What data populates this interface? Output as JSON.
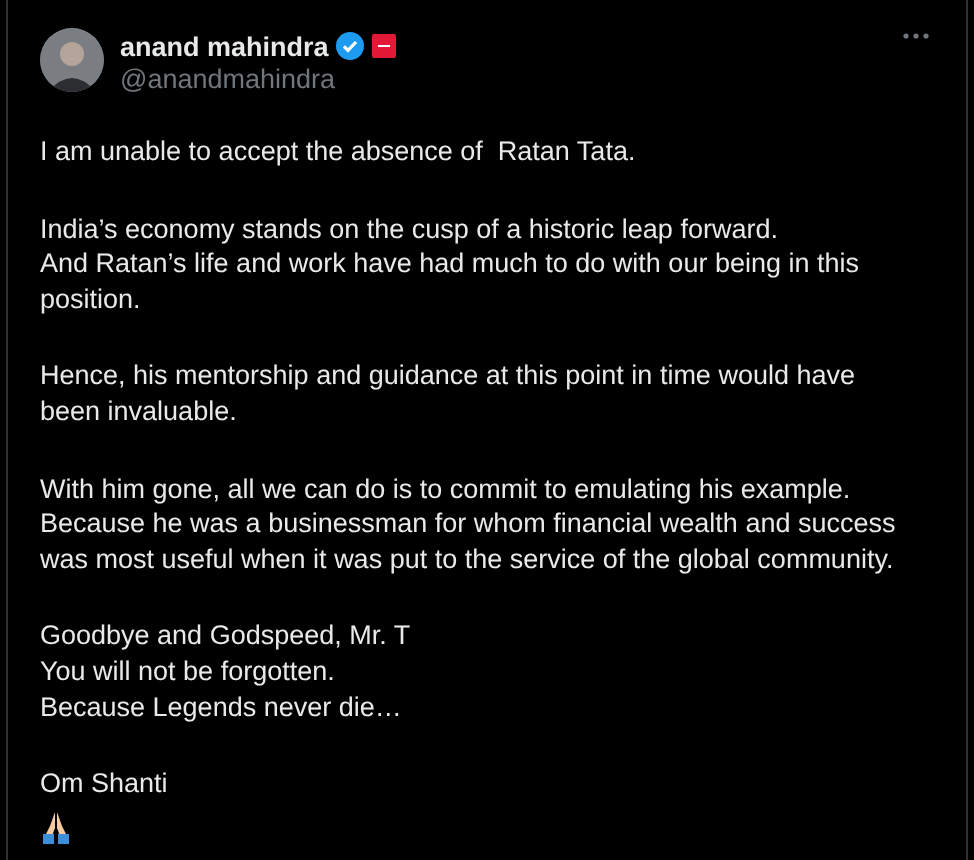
{
  "author": {
    "name": "anand mahindra",
    "handle": "@anandmahindra",
    "verified": true
  },
  "paragraphs": [
    [
      "I am unable to accept the absence of  Ratan Tata."
    ],
    [
      "India’s economy stands on the cusp of a historic leap forward.",
      "And Ratan’s life and work have had much to do with our being in this",
      "position."
    ],
    [
      "Hence, his mentorship and guidance at this point in time would have",
      "been invaluable."
    ],
    [
      "With him gone, all we can do is to commit to emulating his example.",
      "Because he was a businessman for whom financial wealth and success",
      "was most useful when it was put to the service of the global community."
    ],
    [
      "Goodbye and Godspeed, Mr. T",
      "You will not be forgotten.",
      "Because Legends never die…"
    ],
    [
      "Om Shanti"
    ]
  ]
}
